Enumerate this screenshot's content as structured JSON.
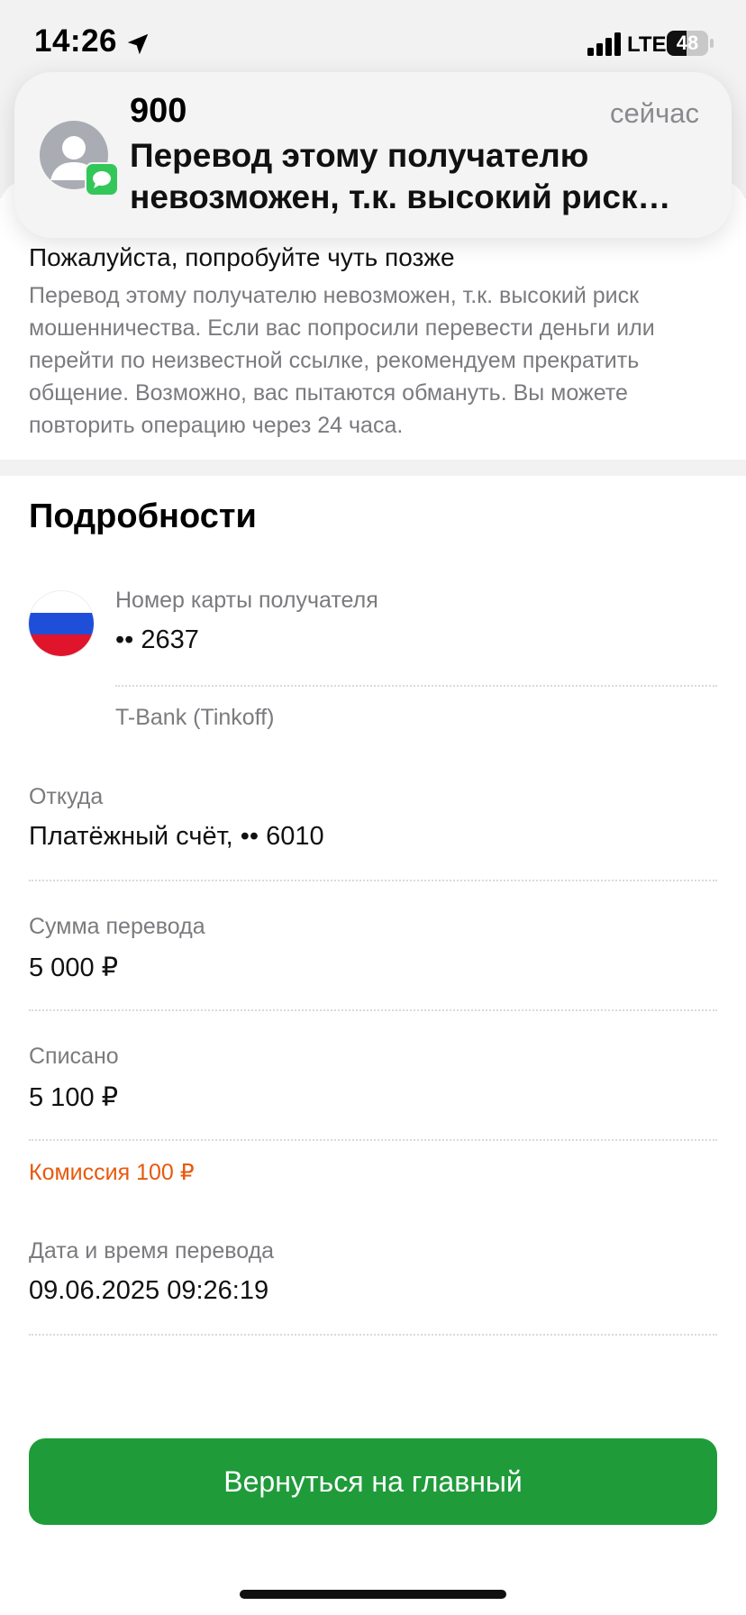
{
  "status_bar": {
    "time": "14:26",
    "network": "LTE",
    "battery": "48",
    "battery_level": 0.48
  },
  "notification": {
    "sender": "900",
    "time": "сейчас",
    "body": "Перевод этому получателю невозможен, т.к. высокий риск…"
  },
  "alert": {
    "title": "Пожалуйста, попробуйте чуть позже",
    "description": "Перевод этому получателю невозможен, т.к. высокий риск мошенничества. Если вас попросили перевести деньги или перейти по неизвестной ссылке, рекомендуем прекратить общение. Возможно, вас пытаются обмануть. Вы можете повторить операцию через 24 часа."
  },
  "details": {
    "title": "Подробности",
    "recipient_card_label": "Номер карты получателя",
    "recipient_card_value": "•• 2637",
    "recipient_bank": "T-Bank (Tinkoff)",
    "from_label": "Откуда",
    "from_value": "Платёжный счёт, •• 6010",
    "amount_label": "Сумма перевода",
    "amount_value": "5 000 ₽",
    "charged_label": "Списано",
    "charged_value": "5 100 ₽",
    "commission": "Комиссия 100 ₽",
    "datetime_label": "Дата и время перевода",
    "datetime_value": "09.06.2025 09:26:19"
  },
  "button": {
    "label": "Вернуться на главный"
  },
  "colors": {
    "primary_green": "#1f9b3a",
    "commission_orange": "#e8590c",
    "muted_text": "#7b7b7f"
  }
}
